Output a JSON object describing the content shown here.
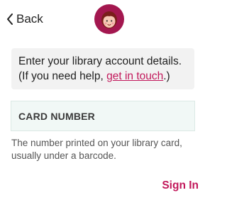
{
  "header": {
    "back_label": "Back",
    "back_icon": "chevron-left-icon",
    "logo_icon": "libby-logo-icon"
  },
  "info": {
    "text_before": "Enter your library account details. (If you need help, ",
    "link_text": "get in touch",
    "text_after": ".)"
  },
  "card_field": {
    "label": "CARD NUMBER"
  },
  "help_text": "The number printed on your library card, usually under a barcode.",
  "actions": {
    "sign_in_label": "Sign In"
  },
  "colors": {
    "accent": "#c2185b",
    "field_background": "#f1f8f6",
    "info_background": "#f2f2f2",
    "logo_background": "#a3174f"
  }
}
